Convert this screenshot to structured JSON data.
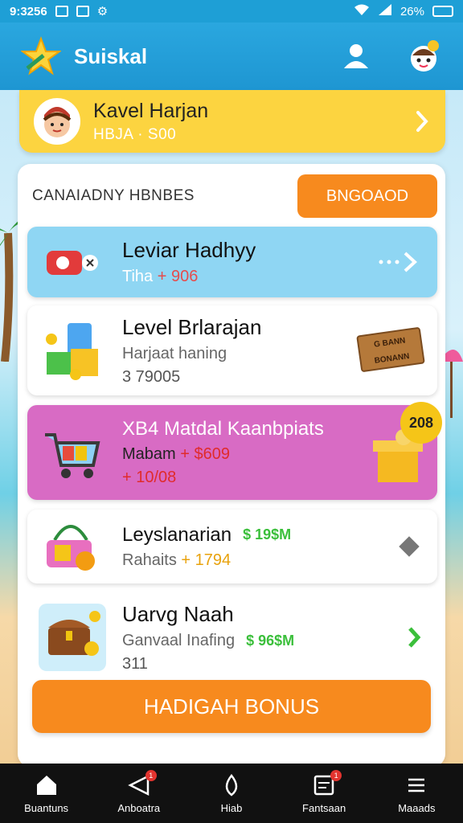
{
  "status_bar": {
    "time": "9:3256",
    "battery": "26%"
  },
  "app_bar": {
    "title": "Suiskal"
  },
  "profile": {
    "name": "Kavel Harjan",
    "subtitle": "HBJA · S00"
  },
  "panel": {
    "title": "CANAIADNY HBNBES",
    "header_button": "BNGOAOD",
    "rows": [
      {
        "title": "Leviar Hadhyy",
        "sub_a": "Tiha",
        "sub_b": "+ 906"
      },
      {
        "title": "Level Brlarajan",
        "sub": "Harjaat haning",
        "value": "3 79005",
        "sign": "G BANN BONANN"
      },
      {
        "title": "XB4 Matdal Kaanbpiats",
        "sub_a": "Mabam",
        "sub_b": "+ $609",
        "value": "+ 10/08",
        "badge": "208"
      },
      {
        "title": "Leyslanarian",
        "amount": "$ 19$M",
        "sub_a": "Rahaits",
        "sub_b": "+ 1794"
      },
      {
        "title": "Uarvg Naah",
        "amount": "$ 96$M",
        "sub": "Ganvaal Inafing",
        "value": "311"
      }
    ],
    "bonus_button": "HADIGAH BONUS"
  },
  "bottom_nav": [
    {
      "label": "Buantuns",
      "icon": "home-icon"
    },
    {
      "label": "Anboatra",
      "icon": "send-icon",
      "badge": "1"
    },
    {
      "label": "Hiab",
      "icon": "drop-icon"
    },
    {
      "label": "Fantsaan",
      "icon": "inbox-icon",
      "badge": "1"
    },
    {
      "label": "Maaads",
      "icon": "menu-icon"
    }
  ],
  "colors": {
    "primary": "#1e9fd6",
    "accent_orange": "#f78a1e",
    "yellow": "#fcd440",
    "row_blue": "#8fd6f3",
    "row_pink": "#d86bc4",
    "green": "#3bbf3b"
  }
}
